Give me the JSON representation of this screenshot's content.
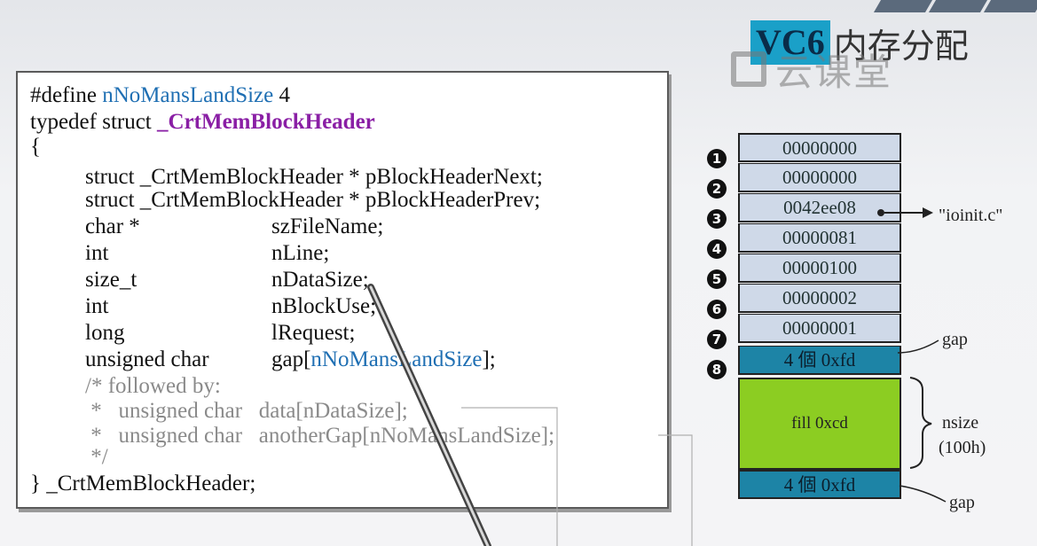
{
  "title": {
    "badge": "VC6",
    "rest": "内存分配"
  },
  "watermark": "云课堂",
  "code": {
    "line1_prefix": "#define ",
    "line1_macro": "nNoMansLandSize",
    "line1_value": " 4",
    "line2_prefix": "typedef struct ",
    "line2_name": "_CrtMemBlockHeader",
    "open_brace": "{",
    "fields": [
      {
        "type": "struct _CrtMemBlockHeader * pBlockHeaderNext;",
        "name": ""
      },
      {
        "type": "struct _CrtMemBlockHeader * pBlockHeaderPrev;",
        "name": ""
      },
      {
        "type": "char *",
        "name": "szFileName;"
      },
      {
        "type": "int",
        "name": "nLine;"
      },
      {
        "type": "size_t",
        "name": "nDataSize;"
      },
      {
        "type": "int",
        "name": "nBlockUse;"
      },
      {
        "type": "long",
        "name": "lRequest;"
      },
      {
        "type": "unsigned char",
        "name_prefix": "gap[",
        "name_macro": "nNoMansLandSize",
        "name_suffix": "];"
      }
    ],
    "comment": [
      "/* followed by:",
      " *   unsigned char   data[nDataSize];",
      " *   unsigned char   anotherGap[nNoMansLandSize];",
      " */"
    ],
    "close": "} _CrtMemBlockHeader;"
  },
  "memory": {
    "rows": [
      {
        "num": "1",
        "value": "00000000"
      },
      {
        "num": "2",
        "value": "00000000"
      },
      {
        "num": "3",
        "value": "0042ee08"
      },
      {
        "num": "4",
        "value": "00000081"
      },
      {
        "num": "5",
        "value": "00000100"
      },
      {
        "num": "6",
        "value": "00000002"
      },
      {
        "num": "7",
        "value": "00000001"
      },
      {
        "num": "8",
        "value": "4 個 0xfd"
      }
    ],
    "fill": "fill 0xcd",
    "tail_gap": "4 個 0xfd",
    "pointer_label": "\"ioinit.c\"",
    "gap_label_top": "gap",
    "gap_label_bottom": "gap",
    "nsize_label": "nsize",
    "nsize_value": "(100h)"
  }
}
